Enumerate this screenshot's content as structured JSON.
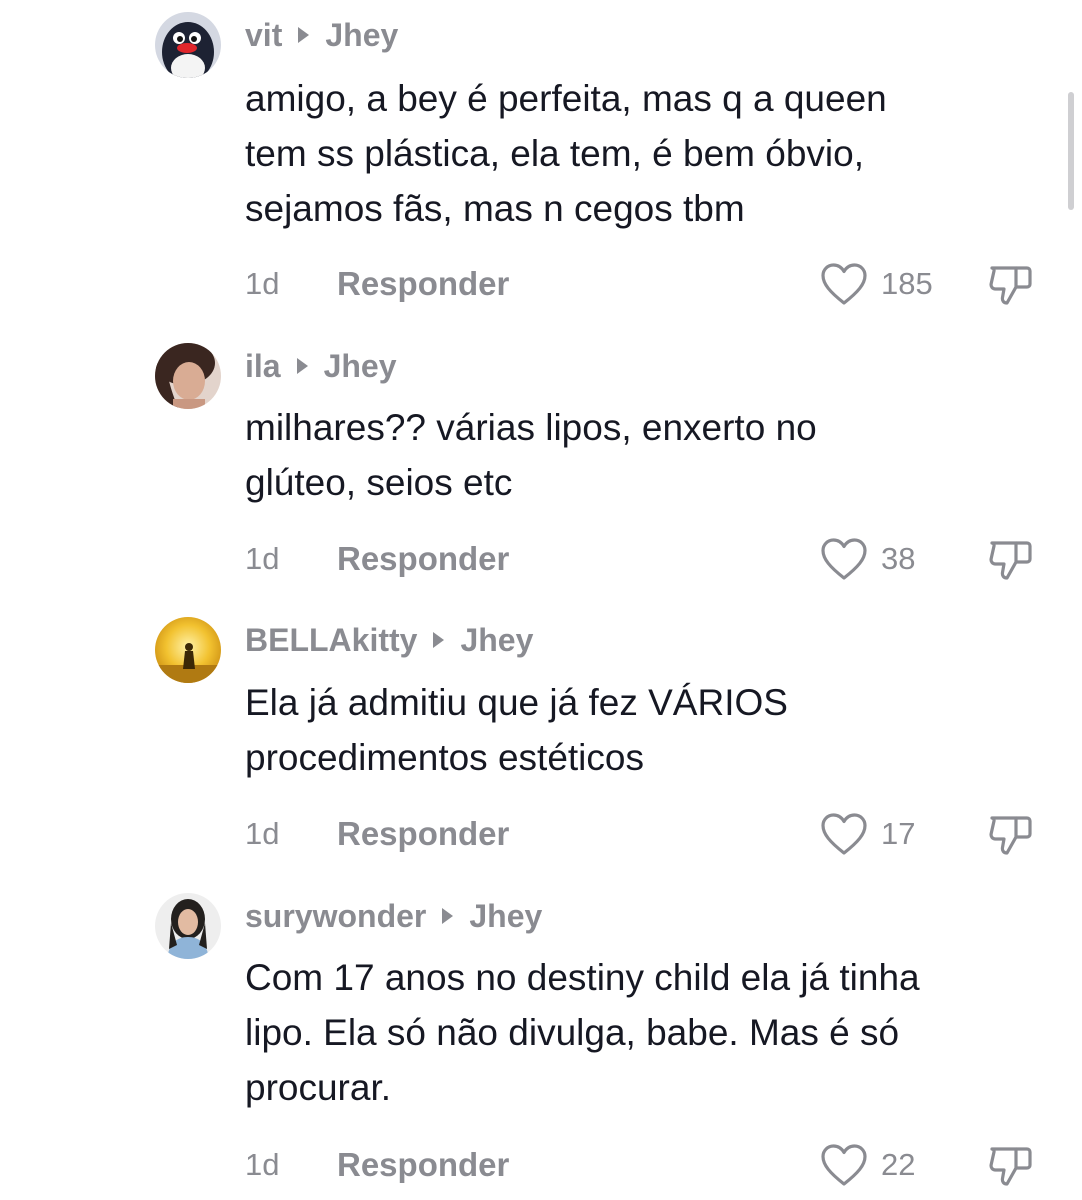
{
  "comments": [
    {
      "username": "vit",
      "reply_to": "Jhey",
      "text": "amigo, a bey é perfeita, mas q a queen\ntem ss plástica, ela tem, é bem óbvio,\nsejamos fãs, mas n cegos tbm",
      "time": "1d",
      "reply_label": "Responder",
      "likes": "185"
    },
    {
      "username": "ila",
      "reply_to": "Jhey",
      "text": "milhares?? várias lipos, enxerto no\nglúteo, seios etc",
      "time": "1d",
      "reply_label": "Responder",
      "likes": "38"
    },
    {
      "username": "BELLAkitty",
      "reply_to": "Jhey",
      "text": "Ela já admitiu que já fez VÁRIOS\nprocedimentos estéticos",
      "time": "1d",
      "reply_label": "Responder",
      "likes": "17"
    },
    {
      "username": "surywonder",
      "reply_to": "Jhey",
      "text": "Com 17 anos no destiny child ela já tinha\nlipo. Ela só não divulga, babe. Mas é só\nprocurar.",
      "time": "1d",
      "reply_label": "Responder",
      "likes": "22"
    }
  ],
  "icons": {
    "like": "heart-outline-icon",
    "dislike": "thumbs-down-icon",
    "reply_arrow": "caret-right-icon"
  },
  "colors": {
    "text": "#161823",
    "muted": "#8a8b91",
    "background": "#ffffff"
  }
}
